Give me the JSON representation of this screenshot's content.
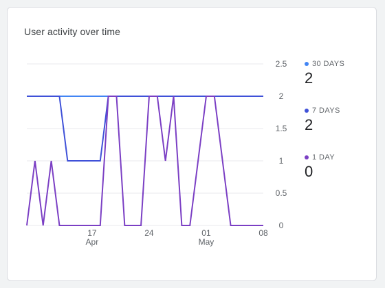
{
  "card": {
    "title": "User activity over time"
  },
  "legend": [
    {
      "label": "30 DAYS",
      "value": "2",
      "color": "#4285f4"
    },
    {
      "label": "7 DAYS",
      "value": "2",
      "color": "#3f51d8"
    },
    {
      "label": "1 DAY",
      "value": "0",
      "color": "#7b3fc4"
    }
  ],
  "chart_data": {
    "type": "line",
    "title": "User activity over time",
    "ylim": [
      0,
      2.5
    ],
    "y_ticks": [
      0,
      0.5,
      1,
      1.5,
      2,
      2.5
    ],
    "y_tick_labels": [
      "0",
      "0.5",
      "1",
      "1.5",
      "2",
      "2.5"
    ],
    "x_ticks": [
      {
        "date": "2023-04-17",
        "label": "17",
        "sublabel": "Apr"
      },
      {
        "date": "2023-04-24",
        "label": "24",
        "sublabel": ""
      },
      {
        "date": "2023-05-01",
        "label": "01",
        "sublabel": "May"
      },
      {
        "date": "2023-05-08",
        "label": "08",
        "sublabel": ""
      }
    ],
    "x": [
      "2023-04-09",
      "2023-04-10",
      "2023-04-11",
      "2023-04-12",
      "2023-04-13",
      "2023-04-14",
      "2023-04-15",
      "2023-04-16",
      "2023-04-17",
      "2023-04-18",
      "2023-04-19",
      "2023-04-20",
      "2023-04-21",
      "2023-04-22",
      "2023-04-23",
      "2023-04-24",
      "2023-04-25",
      "2023-04-26",
      "2023-04-27",
      "2023-04-28",
      "2023-04-29",
      "2023-04-30",
      "2023-05-01",
      "2023-05-02",
      "2023-05-03",
      "2023-05-04",
      "2023-05-05",
      "2023-05-06",
      "2023-05-07",
      "2023-05-08"
    ],
    "grid": true,
    "legend_position": "right",
    "series": [
      {
        "name": "30 DAYS",
        "color": "#4285f4",
        "values": [
          2,
          2,
          2,
          2,
          2,
          2,
          2,
          2,
          2,
          2,
          2,
          2,
          2,
          2,
          2,
          2,
          2,
          2,
          2,
          2,
          2,
          2,
          2,
          2,
          2,
          2,
          2,
          2,
          2,
          2
        ]
      },
      {
        "name": "7 DAYS",
        "color": "#3f51d8",
        "values": [
          2,
          2,
          2,
          2,
          2,
          1,
          1,
          1,
          1,
          1,
          2,
          2,
          2,
          2,
          2,
          2,
          2,
          2,
          2,
          2,
          2,
          2,
          2,
          2,
          2,
          2,
          2,
          2,
          2,
          2
        ]
      },
      {
        "name": "1 DAY",
        "color": "#7b3fc4",
        "values": [
          0,
          1,
          0,
          1,
          0,
          0,
          0,
          0,
          0,
          0,
          2,
          2,
          0,
          0,
          0,
          2,
          2,
          1,
          2,
          0,
          0,
          1,
          2,
          2,
          1,
          0,
          0,
          0,
          0,
          0
        ]
      }
    ]
  }
}
